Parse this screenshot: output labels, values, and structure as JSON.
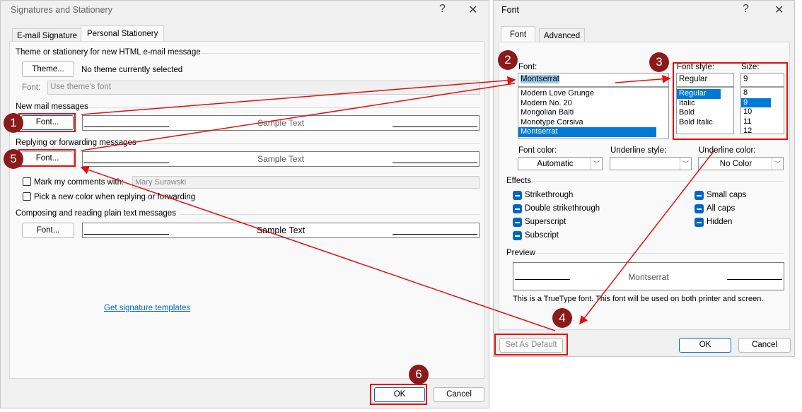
{
  "left": {
    "title": "Signatures and Stationery",
    "help": "?",
    "close": "✕",
    "tabs": [
      "E-mail Signature",
      "Personal Stationery"
    ],
    "theme_section": "Theme or stationery for new HTML e-mail message",
    "theme_button": "Theme...",
    "theme_status": "No theme currently selected",
    "font_label": "Font:",
    "font_value": "Use theme's font",
    "new_mail": "New mail messages",
    "font_button": "Font...",
    "sample": "Sample Text",
    "reply_section": "Replying or forwarding messages",
    "mark_comments": "Mark my comments with:",
    "mark_name": "Mary Surawski",
    "pick_color": "Pick a new color when replying or forwarding",
    "plain_section": "Composing and reading plain text messages",
    "templates_link": "Get signature templates",
    "ok": "OK",
    "cancel": "Cancel"
  },
  "right": {
    "title": "Font",
    "help": "?",
    "close": "✕",
    "tabs": [
      "Font",
      "Advanced"
    ],
    "font_label": "Font:",
    "font_value": "Montserrat",
    "fonts": [
      "Modern Love Grunge",
      "Modern No. 20",
      "Mongolian Baiti",
      "Monotype Corsiva",
      "Montserrat"
    ],
    "style_label": "Font style:",
    "style_value": "Regular",
    "styles": [
      "Regular",
      "Italic",
      "Bold",
      "Bold Italic"
    ],
    "size_label": "Size:",
    "size_value": "9",
    "sizes": [
      "8",
      "9",
      "10",
      "11",
      "12"
    ],
    "font_color_label": "Font color:",
    "font_color": "Automatic",
    "underline_style_label": "Underline style:",
    "underline_style": "",
    "underline_color_label": "Underline color:",
    "underline_color": "No Color",
    "effects_label": "Effects",
    "effects": [
      "Strikethrough",
      "Double strikethrough",
      "Superscript",
      "Subscript",
      "Small caps",
      "All caps",
      "Hidden"
    ],
    "preview_label": "Preview",
    "preview_text": "Montserrat",
    "truetype_note": "This is a TrueType font. This font will be used on both printer and screen.",
    "set_default": "Set As Default",
    "ok": "OK",
    "cancel": "Cancel"
  },
  "annotations": [
    "1",
    "2",
    "3",
    "4",
    "5",
    "6"
  ],
  "colors": {
    "accent": "#0078d7",
    "annotation": "#8b1a1a",
    "highlight": "#e01010"
  }
}
